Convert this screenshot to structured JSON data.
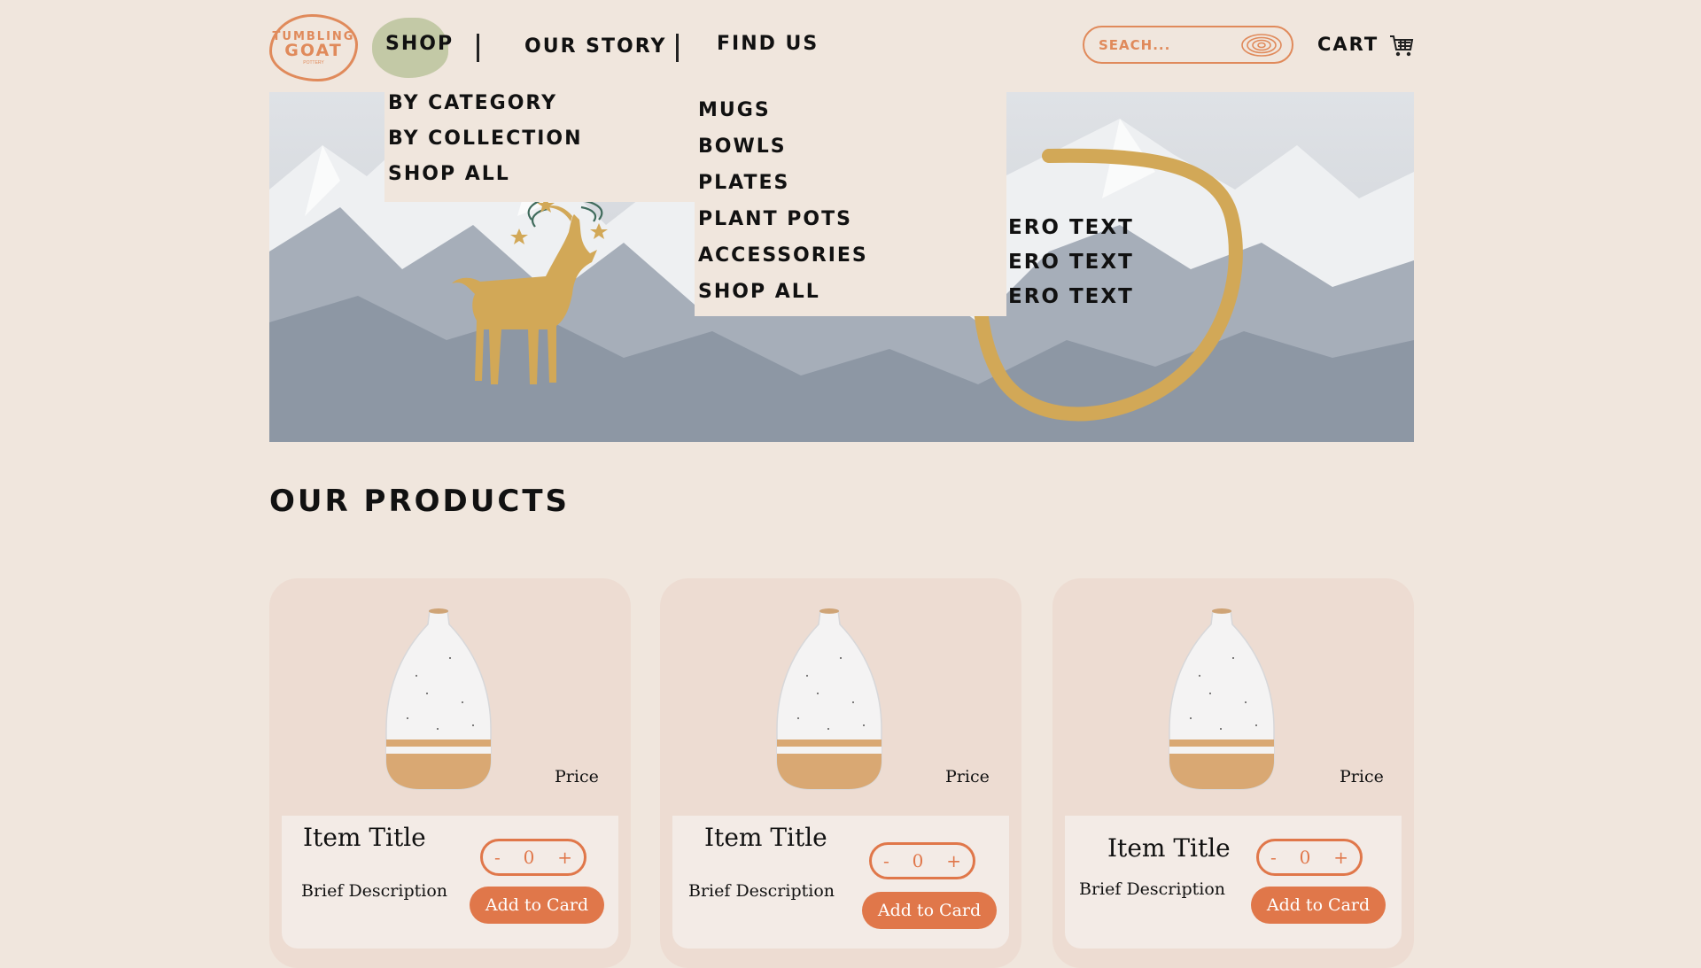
{
  "logo": {
    "line1": "TUMBLING",
    "line2": "GOAT",
    "line3": "POTTERY"
  },
  "nav": {
    "shop": "SHOP",
    "our_story": "OUR STORY",
    "find_us": "FIND US",
    "separator": "|"
  },
  "search": {
    "placeholder": "SEACH..."
  },
  "cart": {
    "label": "CART"
  },
  "shop_menu": [
    "BY CATEGORY",
    "BY COLLECTION",
    "SHOP ALL"
  ],
  "category_menu": [
    "MUGS",
    "BOWLS",
    "PLATES",
    "PLANT POTS",
    "ACCESSORIES",
    "SHOP ALL"
  ],
  "hero": {
    "lines": [
      "ERO TEXT",
      "ERO TEXT",
      "ERO TEXT"
    ]
  },
  "products_section": {
    "title": "OUR PRODUCTS"
  },
  "products": [
    {
      "title": "Item Title",
      "description": "Brief Description",
      "price": "Price",
      "qty": "0",
      "button": "Add to Card"
    },
    {
      "title": "Item Title",
      "description": "Brief Description",
      "price": "Price",
      "qty": "0",
      "button": "Add to Card"
    },
    {
      "title": "Item Title",
      "description": "Brief Description",
      "price": "Price",
      "qty": "0",
      "button": "Add to Card"
    }
  ],
  "stepper": {
    "minus": "-",
    "plus": "+"
  },
  "colors": {
    "background": "#f0e6dd",
    "accent": "#e0774a",
    "gold": "#d2a857",
    "sage": "#c3c9a6",
    "card": "#eddcd2"
  }
}
